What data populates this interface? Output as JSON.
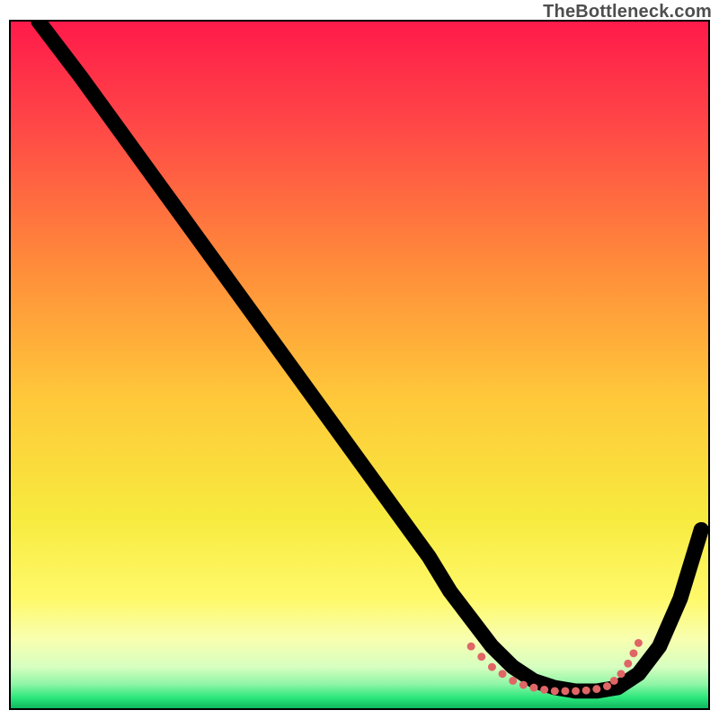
{
  "watermark": "TheBottleneck.com",
  "chart_data": {
    "type": "line",
    "title": "",
    "xlabel": "",
    "ylabel": "",
    "xlim": [
      0,
      100
    ],
    "ylim": [
      0,
      100
    ],
    "grid": false,
    "legend": false,
    "background_gradient": {
      "stops": [
        {
          "offset": 0.0,
          "color": "#ff1a4a"
        },
        {
          "offset": 0.15,
          "color": "#ff4747"
        },
        {
          "offset": 0.35,
          "color": "#ff8a3a"
        },
        {
          "offset": 0.55,
          "color": "#ffc93a"
        },
        {
          "offset": 0.72,
          "color": "#f7ea3e"
        },
        {
          "offset": 0.84,
          "color": "#fff96a"
        },
        {
          "offset": 0.9,
          "color": "#f8ffb0"
        },
        {
          "offset": 0.94,
          "color": "#d6ffc0"
        },
        {
          "offset": 0.965,
          "color": "#8ff5a6"
        },
        {
          "offset": 0.985,
          "color": "#29e67a"
        },
        {
          "offset": 1.0,
          "color": "#0fb85f"
        }
      ]
    },
    "series": [
      {
        "name": "bottleneck-curve",
        "x": [
          4,
          7,
          10,
          15,
          20,
          25,
          30,
          35,
          40,
          45,
          50,
          55,
          60,
          63,
          66,
          69,
          72,
          75,
          78,
          81,
          84,
          87,
          90,
          93,
          96,
          99
        ],
        "y": [
          100,
          96,
          92,
          85,
          78,
          71,
          64,
          57,
          50,
          43,
          36,
          29,
          22,
          17,
          13,
          9,
          6,
          4,
          3,
          2.5,
          2.5,
          3,
          5,
          9,
          16,
          26
        ]
      }
    ],
    "markers": {
      "name": "highlight-region",
      "color": "#e06666",
      "radius": 4.5,
      "points_xy": [
        [
          66,
          9
        ],
        [
          67.5,
          7.5
        ],
        [
          69,
          6
        ],
        [
          70.5,
          5
        ],
        [
          72,
          4
        ],
        [
          73.5,
          3.4
        ],
        [
          75,
          3
        ],
        [
          76.5,
          2.7
        ],
        [
          78,
          2.5
        ],
        [
          79.5,
          2.5
        ],
        [
          81,
          2.5
        ],
        [
          82.5,
          2.6
        ],
        [
          84,
          2.8
        ],
        [
          85.5,
          3.2
        ],
        [
          86.5,
          4
        ],
        [
          87.5,
          5
        ],
        [
          88.5,
          6.5
        ],
        [
          89.3,
          8
        ],
        [
          90,
          9.5
        ]
      ]
    }
  }
}
